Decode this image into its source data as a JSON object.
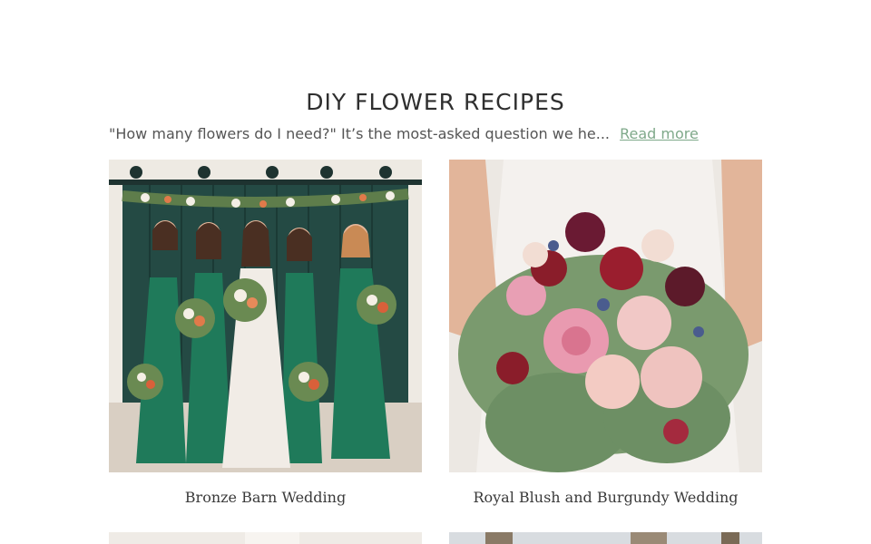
{
  "section": {
    "title": "DIY FLOWER RECIPES",
    "intro": "\"How many flowers do I need?\" It’s the most-asked question we he...",
    "read_more": "Read more"
  },
  "recipes": [
    {
      "caption": "Bronze Barn Wedding",
      "image": "bridal-party-green-dresses-photo"
    },
    {
      "caption": "Royal Blush and Burgundy Wedding",
      "image": "blush-burgundy-bouquet-photo"
    },
    {
      "caption": "",
      "image": "lace-dress-photo"
    },
    {
      "caption": "",
      "image": "trees-photo"
    }
  ],
  "colors": {
    "link": "#7fa98a",
    "title": "#2f2f2f"
  }
}
